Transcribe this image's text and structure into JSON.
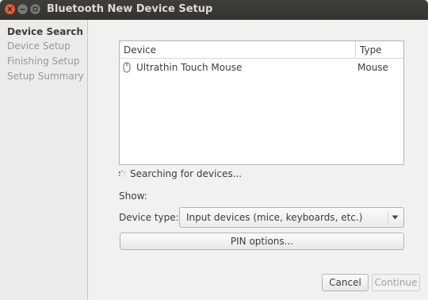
{
  "window": {
    "title": "Bluetooth New Device Setup",
    "buttons": {
      "close_icon": "close-icon",
      "minimize_icon": "minimize-icon",
      "maximize_icon": "maximize-icon"
    }
  },
  "sidebar": {
    "items": [
      {
        "label": "Device Search",
        "active": true
      },
      {
        "label": "Device Setup",
        "active": false
      },
      {
        "label": "Finishing Setup",
        "active": false
      },
      {
        "label": "Setup Summary",
        "active": false
      }
    ]
  },
  "device_list": {
    "columns": [
      "Device",
      "Type"
    ],
    "rows": [
      {
        "icon": "mouse-icon",
        "name": "Ultrathin Touch Mouse",
        "type": "Mouse"
      }
    ]
  },
  "status": {
    "icon": "spinner-icon",
    "text": "Searching for devices..."
  },
  "filter": {
    "show_label": "Show:",
    "device_type_label": "Device type:",
    "device_type_value": "Input devices (mice, keyboards, etc.)"
  },
  "actions": {
    "pin_options": "PIN options...",
    "cancel": "Cancel",
    "continue": "Continue",
    "continue_enabled": false
  },
  "colors": {
    "titlebar": "#3c3b37",
    "close_button": "#e2562b",
    "window_buttons": "#6e6c66",
    "background": "#f2f1f0"
  }
}
